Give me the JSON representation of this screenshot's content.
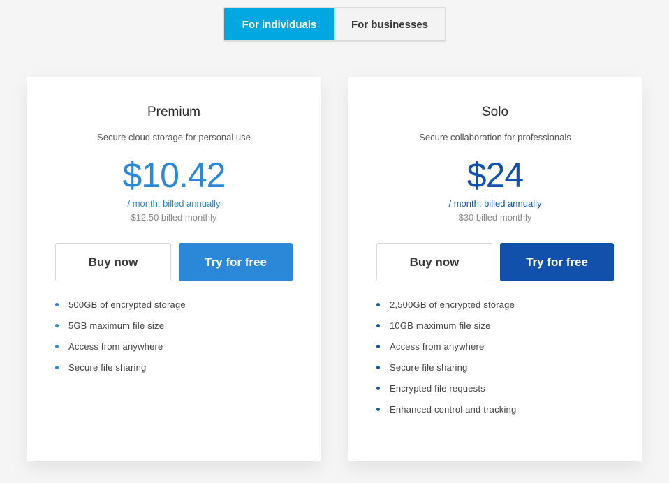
{
  "toggle": {
    "individuals_label": "For individuals",
    "businesses_label": "For businesses",
    "active": "individuals"
  },
  "colors": {
    "toggle_active": "#00a7e1",
    "premium_accent": "#2b88d8",
    "solo_accent": "#1150ab"
  },
  "plans": [
    {
      "name": "Premium",
      "description": "Secure cloud storage for personal use",
      "price": "$10.42",
      "billing": "/ month, billed annually",
      "monthly": "$12.50 billed monthly",
      "buy_label": "Buy now",
      "try_label": "Try for free",
      "features": [
        "500GB of encrypted storage",
        "5GB maximum file size",
        "Access from anywhere",
        "Secure file sharing"
      ]
    },
    {
      "name": "Solo",
      "description": "Secure collaboration for professionals",
      "price": "$24",
      "billing": "/ month, billed annually",
      "monthly": "$30 billed monthly",
      "buy_label": "Buy now",
      "try_label": "Try for free",
      "features": [
        "2,500GB of encrypted storage",
        "10GB maximum file size",
        "Access from anywhere",
        "Secure file sharing",
        "Encrypted file requests",
        "Enhanced control and tracking"
      ]
    }
  ]
}
